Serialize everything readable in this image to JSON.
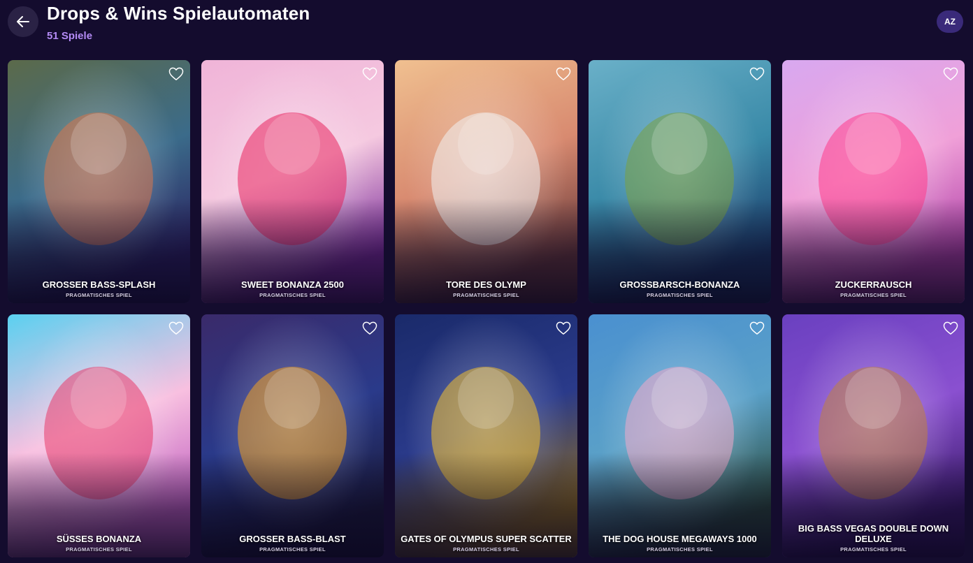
{
  "header": {
    "title": "Drops & Wins Spielautomaten",
    "count": "51 Spiele",
    "sort_label": "AZ",
    "back_icon": "arrow-left-icon"
  },
  "games": [
    {
      "name": "GROSSER BASS-SPLASH",
      "provider": "PRAGMATISCHES SPIEL",
      "bg": [
        "#5b6a4a",
        "#3b6b8a",
        "#2a2060"
      ],
      "accent": "#d8744a"
    },
    {
      "name": "SWEET BONANZA 2500",
      "provider": "PRAGMATISCHES SPIEL",
      "bg": [
        "#f0b4d8",
        "#f5c9e0",
        "#7a2a9a"
      ],
      "accent": "#e8245e"
    },
    {
      "name": "TORE DES OLYMP",
      "provider": "PRAGMATISCHES SPIEL",
      "bg": [
        "#f0c090",
        "#d88a70",
        "#6a3a3a"
      ],
      "accent": "#f0f0f0"
    },
    {
      "name": "GROSSBARSCH-BONANZA",
      "provider": "PRAGMATISCHES SPIEL",
      "bg": [
        "#6ab0c8",
        "#3a8aa8",
        "#1a3a68"
      ],
      "accent": "#7aa040"
    },
    {
      "name": "ZUCKERRAUSCH",
      "provider": "PRAGMATISCHES SPIEL",
      "bg": [
        "#d8a8f0",
        "#f0a0d8",
        "#b040a8"
      ],
      "accent": "#ff3a8a"
    },
    {
      "name": "SÜSSES BONANZA",
      "provider": "PRAGMATISCHES SPIEL",
      "bg": [
        "#5ad0f0",
        "#f8c0e0",
        "#c060c0"
      ],
      "accent": "#e83a6a"
    },
    {
      "name": "GROSSER BASS-BLAST",
      "provider": "PRAGMATISCHES SPIEL",
      "bg": [
        "#3a2a6a",
        "#2a3a8a",
        "#1a1a3a"
      ],
      "accent": "#f0a020"
    },
    {
      "name": "GATES OF OLYMPUS SUPER SCATTER",
      "provider": "PRAGMATISCHES SPIEL",
      "bg": [
        "#1a2a6a",
        "#2a3a8a",
        "#8a6a20"
      ],
      "accent": "#f0c030"
    },
    {
      "name": "THE DOG HOUSE MEGAWAYS 1000",
      "provider": "PRAGMATISCHES SPIEL",
      "bg": [
        "#4a90d0",
        "#5aa0c8",
        "#2a4a3a"
      ],
      "accent": "#f0a8c8"
    },
    {
      "name": "BIG BASS VEGAS DOUBLE DOWN DELUXE",
      "provider": "PRAGMATISCHES SPIEL",
      "bg": [
        "#6a40c0",
        "#8a50d0",
        "#3a1a6a"
      ],
      "accent": "#c08040"
    }
  ],
  "icons": {
    "favorite": "heart-outline-icon"
  }
}
